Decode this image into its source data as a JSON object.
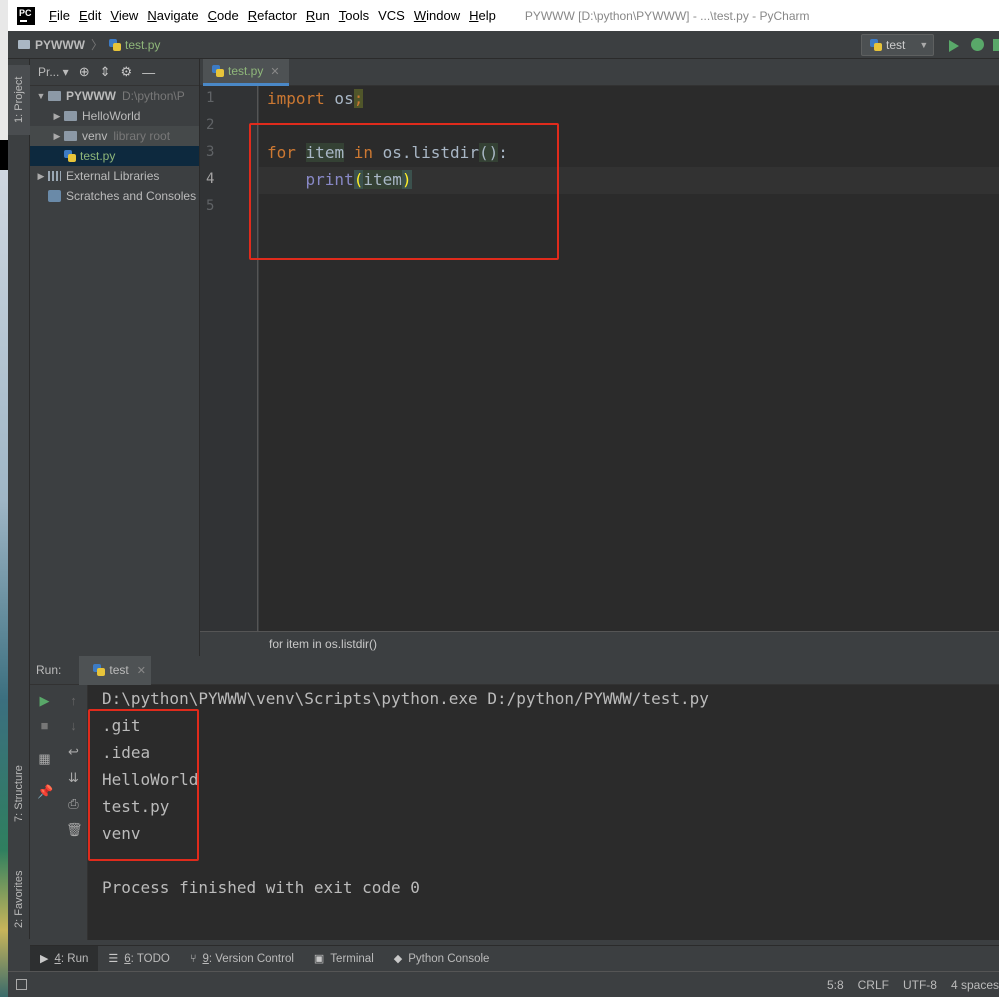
{
  "window": {
    "logo": "PC",
    "title": "PYWWW [D:\\python\\PYWWW] - ...\\test.py - PyCharm"
  },
  "menu": [
    {
      "u": "F",
      "rest": "ile"
    },
    {
      "u": "E",
      "rest": "dit"
    },
    {
      "u": "V",
      "rest": "iew"
    },
    {
      "u": "N",
      "rest": "avigate"
    },
    {
      "u": "C",
      "rest": "ode"
    },
    {
      "u": "R",
      "rest": "efactor"
    },
    {
      "u": "R",
      "rest": "un",
      "pre": ""
    },
    {
      "u": "T",
      "rest": "ools"
    },
    {
      "u": "",
      "rest": "VCS"
    },
    {
      "u": "W",
      "rest": "indow"
    },
    {
      "u": "H",
      "rest": "elp"
    }
  ],
  "navbar": {
    "project": "PYWWW",
    "file": "test.py",
    "run_config": "test"
  },
  "sidebar_tabs": {
    "project": "1: Project",
    "structure": "7: Structure",
    "favorites": "2: Favorites"
  },
  "project_panel": {
    "title": "Pr...",
    "tree": [
      {
        "label": "PYWWW",
        "hint": "D:\\python\\P",
        "arrow": "▼",
        "indent": 4,
        "kind": "folder",
        "style": "bold"
      },
      {
        "label": "HelloWorld",
        "hint": "",
        "arrow": "▶",
        "indent": 20,
        "kind": "folder",
        "style": ""
      },
      {
        "label": "venv",
        "hint": "library root",
        "arrow": "▶",
        "indent": 20,
        "kind": "folder",
        "style": "",
        "row": "hl"
      },
      {
        "label": "test.py",
        "hint": "",
        "arrow": "",
        "indent": 34,
        "kind": "py",
        "style": "green",
        "row": "sel"
      },
      {
        "label": "External Libraries",
        "hint": "",
        "arrow": "▶",
        "indent": 4,
        "kind": "lib",
        "style": ""
      },
      {
        "label": "Scratches and Consoles",
        "hint": "",
        "arrow": "",
        "indent": 18,
        "kind": "scratch",
        "style": ""
      }
    ]
  },
  "editor": {
    "tab": "test.py",
    "line_numbers": [
      "1",
      "2",
      "3",
      "4",
      "5"
    ],
    "code": {
      "l1_kw": "import",
      "l1_mod": " os",
      "l1_semi": ";",
      "l3_for": "for",
      "l3_var": "item",
      "l3_in": "in",
      "l3_call": " os.listdir",
      "l3_open": "(",
      "l3_close": ")",
      "l3_colon": ":",
      "l4_print": "print",
      "l4_open": "(",
      "l4_arg": "item",
      "l4_close": ")"
    },
    "breadcrumb": "for item in os.listdir()"
  },
  "run_panel": {
    "label": "Run:",
    "tab": "test",
    "console": [
      "D:\\python\\PYWWW\\venv\\Scripts\\python.exe D:/python/PYWWW/test.py",
      ".git",
      ".idea",
      "HelloWorld",
      "test.py",
      "venv",
      "",
      "Process finished with exit code 0"
    ]
  },
  "bottom_tabs": [
    {
      "num": "4",
      "label": ": Run",
      "icon": "run-icon",
      "glyph": "▶"
    },
    {
      "num": "6",
      "label": ": TODO",
      "icon": "todo-icon",
      "glyph": "☰"
    },
    {
      "num": "9",
      "label": ": Version Control",
      "icon": "vcs-icon",
      "glyph": "⑂"
    },
    {
      "num": "",
      "label": "Terminal",
      "icon": "terminal-icon",
      "glyph": "▣"
    },
    {
      "num": "",
      "label": "Python Console",
      "icon": "python-icon",
      "glyph": "◆"
    }
  ],
  "status": {
    "position": "5:8",
    "line_sep": "CRLF",
    "encoding": "UTF-8",
    "indent": "4 spaces"
  },
  "colors": {
    "accent_red": "#e02b1c",
    "run_green": "#59a869",
    "keyword": "#cc7832"
  }
}
